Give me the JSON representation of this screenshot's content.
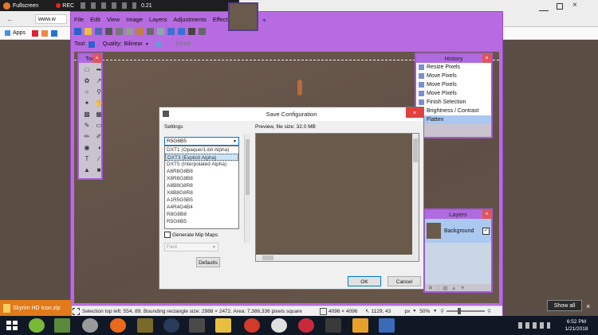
{
  "recorder": {
    "fullscreen_label": "Fullscreen",
    "rec_label": "REC"
  },
  "browser": {
    "url_fragment": "www.w",
    "bookmark_apps": "Apps"
  },
  "app": {
    "version": "0.21"
  },
  "menu": [
    "File",
    "Edit",
    "View",
    "Image",
    "Layers",
    "Adjustments",
    "Effects"
  ],
  "toolbar": {
    "tool_label": "Tool:",
    "quality_label": "Quality:",
    "quality_value": "Bilinear",
    "finish_label": "Finish"
  },
  "history": {
    "title": "History",
    "items": [
      "Resize Pixels",
      "Move Pixels",
      "Move Pixels",
      "Move Pixels",
      "Finish Selection",
      "Brightness / Contrast",
      "Flatten"
    ],
    "selected_index": 6
  },
  "layers": {
    "title": "Layers",
    "items": [
      "Background"
    ]
  },
  "dialog": {
    "title": "Save Configuration",
    "settings_label": "Settings",
    "preview_label": "Preview, file size: 32.0 MB",
    "format_selected": "R5G6B5",
    "format_options": [
      "DXT1 (Opaque/1-bit Alpha)",
      "DXT3 (Explicit Alpha)",
      "DXT5 (Interpolated Alpha)",
      "A8R8G8B8",
      "X8R8G8B8",
      "A8B8G8R8",
      "X8B8G8R8",
      "A1R5G5B5",
      "A4R4G4B4",
      "R8G8B8",
      "R5G6B5"
    ],
    "highlighted_option": "DXT3 (Explicit Alpha)",
    "mipmaps_label": "Generate Mip Maps",
    "mip_filter": "Fant",
    "defaults_label": "Defaults",
    "ok_label": "OK",
    "cancel_label": "Cancel"
  },
  "status": {
    "selection_text": "Selection top left: 554, 89. Bounding rectangle size: 2988 × 2472. Area: 7,386,336 pixels square",
    "image_size": "4096 × 4096",
    "cursor_pos": "1129, 43",
    "unit": "px",
    "zoom": "50%"
  },
  "download": {
    "filename": "Skyrim HD Icon.zip",
    "show_all": "Show all"
  },
  "clock": {
    "time": "6:52 PM",
    "date": "1/21/2018"
  }
}
